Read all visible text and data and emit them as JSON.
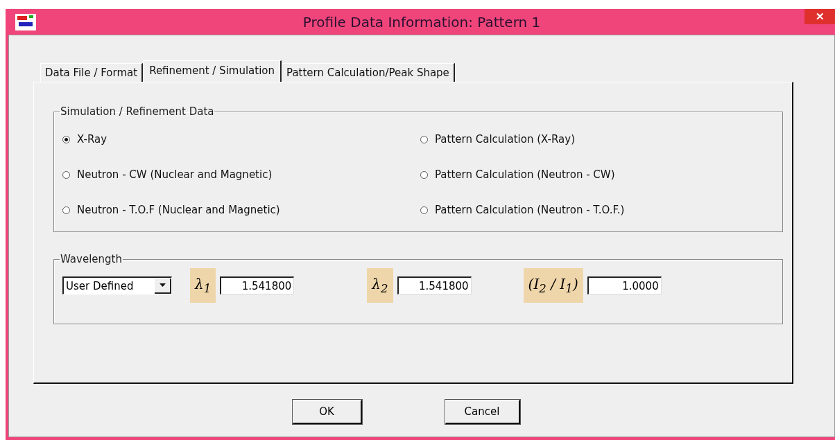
{
  "window": {
    "title": "Profile Data Information: Pattern 1",
    "close": "✕"
  },
  "tabs": [
    {
      "label": "Data File / Format",
      "selected": false
    },
    {
      "label": "Refinement / Simulation",
      "selected": true
    },
    {
      "label": "Pattern Calculation/Peak Shape",
      "selected": false
    }
  ],
  "simulation_group": {
    "title": "Simulation / Refinement Data",
    "options": [
      {
        "label": "X-Ray",
        "selected": true
      },
      {
        "label": "Pattern Calculation (X-Ray)",
        "selected": false
      },
      {
        "label": "Neutron - CW (Nuclear and Magnetic)",
        "selected": false
      },
      {
        "label": "Pattern Calculation (Neutron - CW)",
        "selected": false
      },
      {
        "label": "Neutron - T.O.F (Nuclear and Magnetic)",
        "selected": false
      },
      {
        "label": "Pattern Calculation (Neutron - T.O.F.)",
        "selected": false
      }
    ]
  },
  "wavelength_group": {
    "title": "Wavelength",
    "source": "User Defined",
    "fields": [
      {
        "label": "λ$_{1}$",
        "value": "1.541800"
      },
      {
        "label": "λ$_{2}$",
        "value": "1.541800"
      },
      {
        "label": "(I$_{2}$ / I$_{1}$)",
        "value": "1.0000"
      }
    ]
  },
  "buttons": [
    "OK",
    "Cancel"
  ]
}
